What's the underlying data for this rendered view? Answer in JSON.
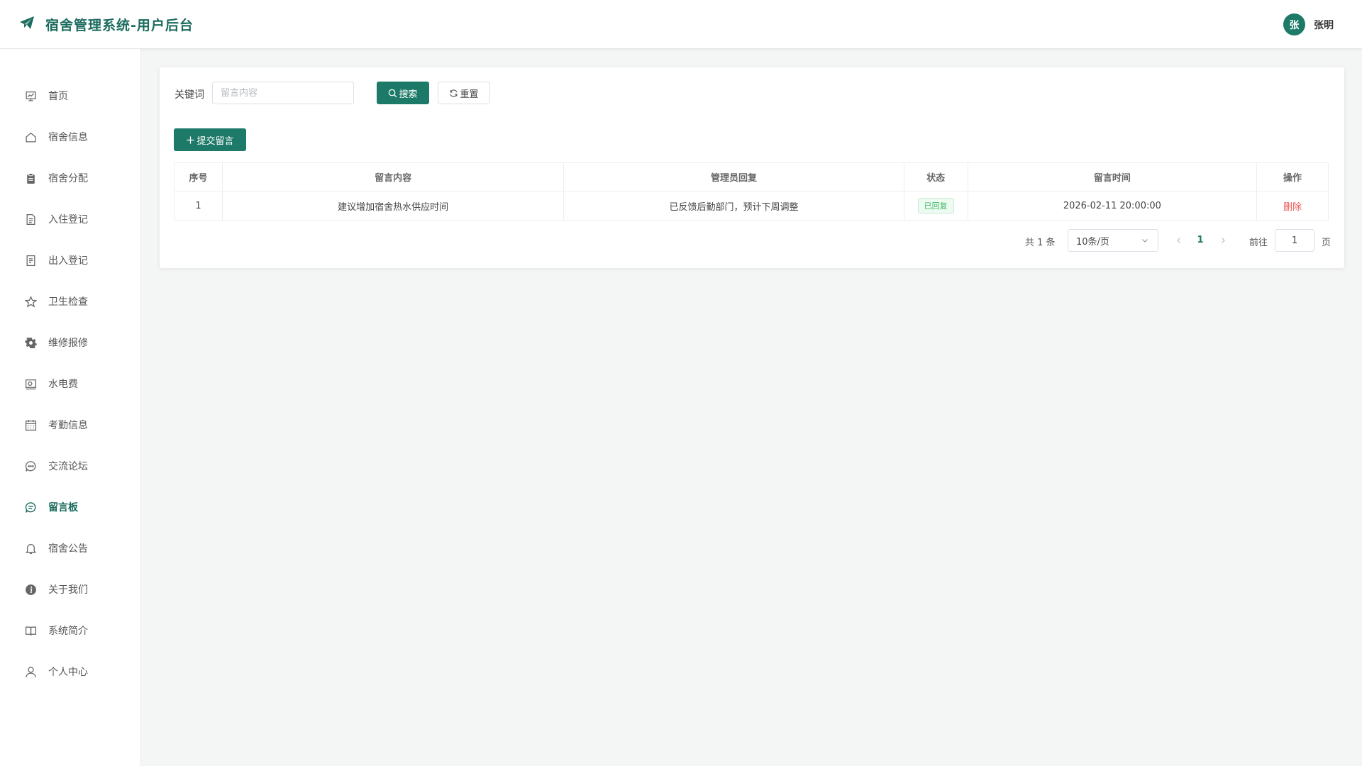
{
  "app": {
    "title": "宿舍管理系统-用户后台",
    "brand_color": "#1b6b5e"
  },
  "user": {
    "avatar_text": "张",
    "name": "张明"
  },
  "sidebar": {
    "items": [
      {
        "label": "首页",
        "icon": "chart-board-icon"
      },
      {
        "label": "宿舍信息",
        "icon": "house-icon"
      },
      {
        "label": "宿舍分配",
        "icon": "clipboard-icon"
      },
      {
        "label": "入住登记",
        "icon": "document-icon"
      },
      {
        "label": "出入登记",
        "icon": "ticket-icon"
      },
      {
        "label": "卫生检查",
        "icon": "star-icon"
      },
      {
        "label": "维修报修",
        "icon": "gear-icon"
      },
      {
        "label": "水电费",
        "icon": "money-icon"
      },
      {
        "label": "考勤信息",
        "icon": "calendar-icon"
      },
      {
        "label": "交流论坛",
        "icon": "chat-dots-icon"
      },
      {
        "label": "留言板",
        "icon": "chat-lines-icon",
        "active": true
      },
      {
        "label": "宿舍公告",
        "icon": "bell-icon"
      },
      {
        "label": "关于我们",
        "icon": "info-icon"
      },
      {
        "label": "系统简介",
        "icon": "book-icon"
      },
      {
        "label": "个人中心",
        "icon": "user-icon"
      }
    ]
  },
  "search": {
    "label": "关键词",
    "placeholder": "留言内容",
    "search_button": "搜索",
    "reset_button": "重置"
  },
  "toolbar": {
    "submit_label": "提交留言"
  },
  "table": {
    "headers": [
      "序号",
      "留言内容",
      "管理员回复",
      "状态",
      "留言时间",
      "操作"
    ],
    "rows": [
      {
        "index": "1",
        "content": "建议增加宿舍热水供应时间",
        "reply": "已反馈后勤部门，预计下周调整",
        "status": "已回复",
        "time": "2026-02-11 20:00:00",
        "action": "删除"
      }
    ]
  },
  "pagination": {
    "total": "共 1 条",
    "page_size": "10条/页",
    "current_page": "1",
    "goto_label": "前往",
    "goto_value": "1",
    "page_suffix": "页"
  }
}
